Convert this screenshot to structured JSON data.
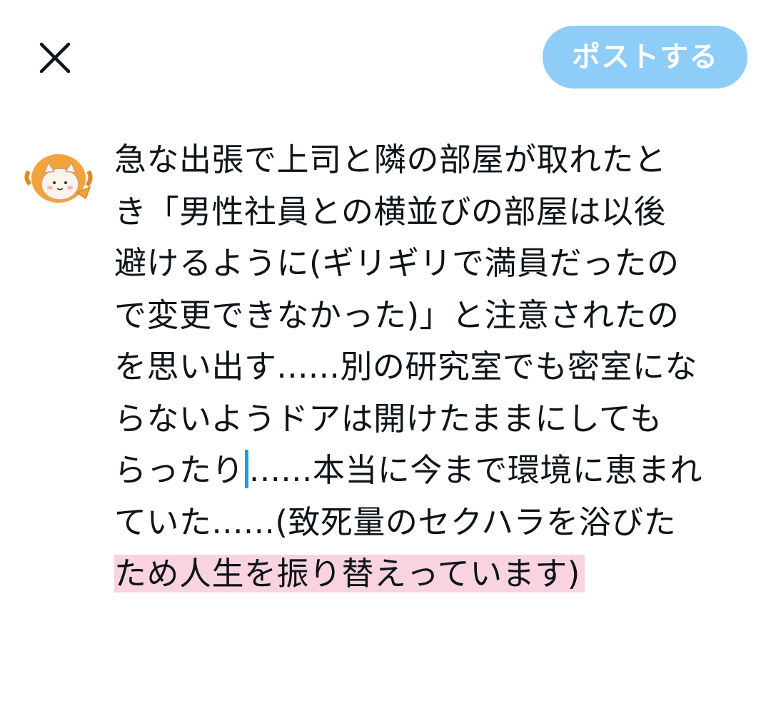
{
  "header": {
    "close_icon": "close-icon",
    "post_label": "ポストする",
    "post_color": "#8ecdf7"
  },
  "composer": {
    "avatar_icon": "cat-avatar-icon",
    "lines": [
      "急な出張で上司と隣の部屋が取れたと",
      "き「男性社員との横並びの部屋は以後",
      "避けるように(ギリギリで満員だったの",
      "で変更できなかった)」と注意されたの",
      "を思い出す......別の研究室でも密室にな",
      "らないようドアは開けたままにしても",
      "らったり",
      "......本当に今まで環境に恵まれ",
      "ていた......(致死量のセクハラを浴びた"
    ],
    "overflow_text": "ため人生を振り替えっています)",
    "caret_color": "#1d9bf0",
    "overflow_highlight_color": "#f9d4e0"
  }
}
